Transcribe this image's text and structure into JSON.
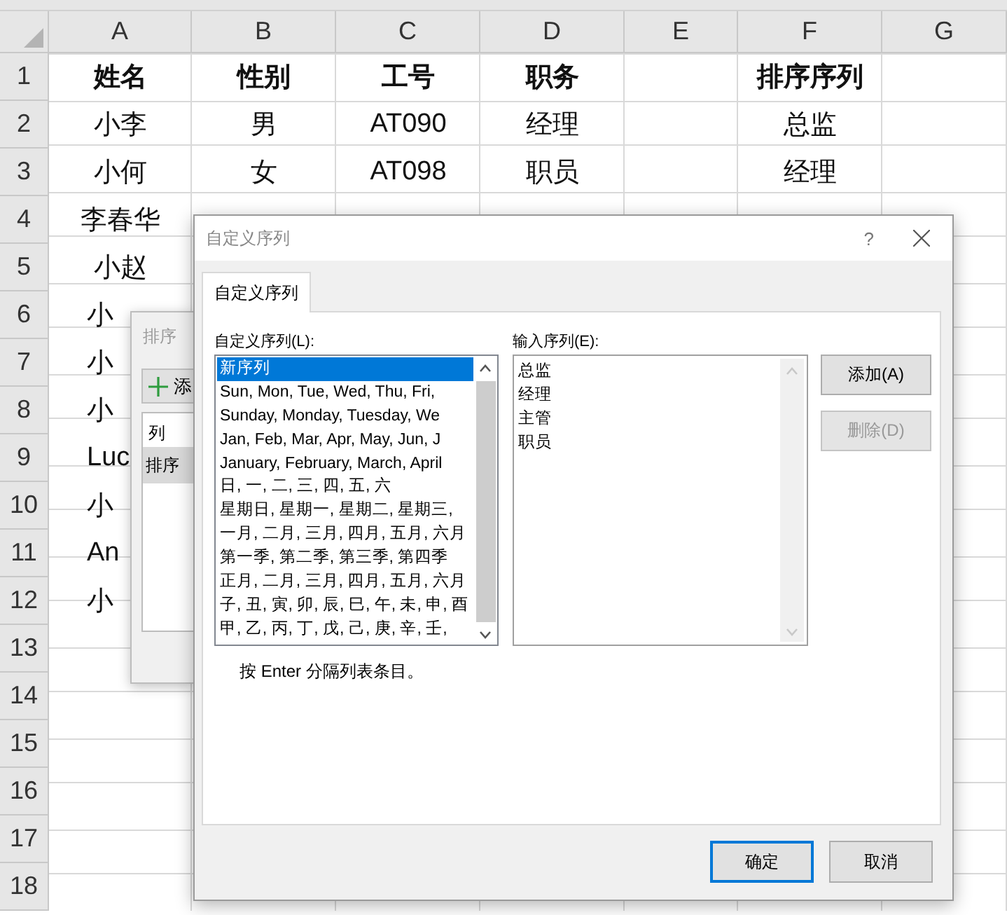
{
  "sheet": {
    "columns": [
      "A",
      "B",
      "C",
      "D",
      "E",
      "F",
      "G"
    ],
    "header_row": {
      "number": "1",
      "cells": [
        "姓名",
        "性别",
        "工号",
        "职务",
        null,
        "排序序列",
        null
      ]
    },
    "rows": [
      {
        "number": "2",
        "cells": [
          "小李",
          "男",
          "AT090",
          "经理",
          null,
          "总监",
          null
        ]
      },
      {
        "number": "3",
        "cells": [
          "小何",
          "女",
          "AT098",
          "职员",
          null,
          "经理",
          null
        ]
      },
      {
        "number": "4",
        "cells": [
          "李春华"
        ]
      },
      {
        "number": "5",
        "cells": [
          "小赵"
        ]
      },
      {
        "number": "6",
        "cells": [
          "小"
        ]
      },
      {
        "number": "7",
        "cells": [
          "小"
        ]
      },
      {
        "number": "8",
        "cells": [
          "小"
        ]
      },
      {
        "number": "9",
        "cells": [
          "Luc"
        ]
      },
      {
        "number": "10",
        "cells": [
          "小"
        ]
      },
      {
        "number": "11",
        "cells": [
          "An"
        ]
      },
      {
        "number": "12",
        "cells": [
          "小"
        ]
      },
      {
        "number": "13"
      },
      {
        "number": "14"
      },
      {
        "number": "15"
      },
      {
        "number": "16"
      },
      {
        "number": "17"
      },
      {
        "number": "18"
      }
    ]
  },
  "sort_dialog": {
    "title": "排序",
    "add_button": "添",
    "list_header": "列",
    "levels": [
      {
        "label": "排序",
        "selected": true
      }
    ]
  },
  "custom_lists_dialog": {
    "title": "自定义序列",
    "help": "?",
    "tabs": [
      {
        "label": "自定义序列",
        "selected": true
      }
    ],
    "lists_label": "自定义序列(L):",
    "lists": [
      {
        "text": "新序列",
        "selected": true
      },
      {
        "text": "Sun, Mon, Tue, Wed, Thu, Fri,",
        "selected": false
      },
      {
        "text": "Sunday, Monday, Tuesday, We",
        "selected": false
      },
      {
        "text": "Jan, Feb, Mar, Apr, May, Jun, J",
        "selected": false
      },
      {
        "text": "January, February, March, April",
        "selected": false
      },
      {
        "text": "日, 一, 二, 三, 四, 五, 六",
        "selected": false
      },
      {
        "text": "星期日, 星期一, 星期二, 星期三,",
        "selected": false
      },
      {
        "text": "一月, 二月, 三月, 四月, 五月, 六月",
        "selected": false
      },
      {
        "text": "第一季, 第二季, 第三季, 第四季",
        "selected": false
      },
      {
        "text": "正月, 二月, 三月, 四月, 五月, 六月",
        "selected": false
      },
      {
        "text": "子, 丑, 寅, 卯, 辰, 巳, 午, 未, 申, 酉",
        "selected": false
      },
      {
        "text": "甲, 乙, 丙, 丁, 戊, 己, 庚, 辛, 壬,",
        "selected": false
      }
    ],
    "entries_label": "输入序列(E):",
    "entries": [
      "总监",
      "经理",
      "主管",
      "职员"
    ],
    "side_buttons": [
      {
        "label": "添加(A)",
        "disabled": false
      },
      {
        "label": "删除(D)",
        "disabled": true
      }
    ],
    "hint": "按 Enter 分隔列表条目。",
    "footer_buttons": [
      {
        "label": "确定",
        "default": true
      },
      {
        "label": "取消",
        "default": false
      }
    ]
  }
}
